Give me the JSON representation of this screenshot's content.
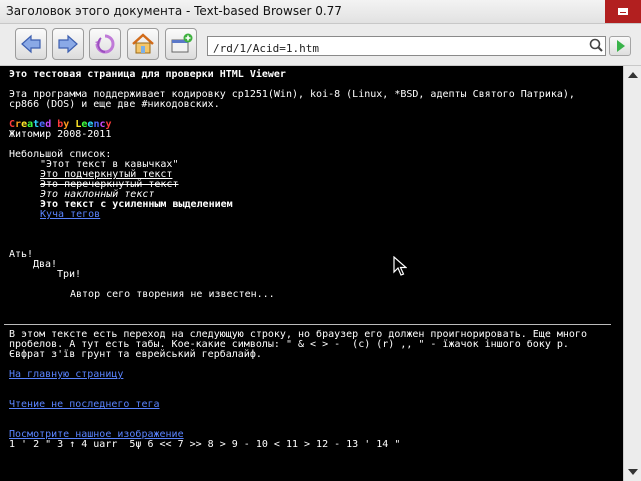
{
  "window": {
    "title": "Заголовок этого документа - Text-based Browser 0.77"
  },
  "toolbar": {
    "back_icon": "back-arrow-icon",
    "forward_icon": "forward-arrow-icon",
    "reload_icon": "reload-icon",
    "home_icon": "home-icon",
    "bookmark_icon": "add-bookmark-icon",
    "url": "/rd/1/Acid=1.htm"
  },
  "page": {
    "heading": "Это тестовая страница для проверки HTML Viewer",
    "intro_1": "Эта программа поддерживает кодировку cp1251(Win), koi-8 (Linux, *BSD, адепты Святого Патрика),",
    "intro_2": "cp866 (DOS) и еще две #никодовских.",
    "created_by": [
      "C",
      "r",
      "e",
      "a",
      "t",
      "e",
      "d",
      " ",
      "b",
      "y",
      " ",
      "L",
      "e",
      "e",
      "n",
      "c",
      "y"
    ],
    "created_colors": [
      "#ff3b3b",
      "#ff9d1f",
      "#ffe62a",
      "#40ff40",
      "#2fd7ff",
      "#4d6bff",
      "#c84dff",
      "#fff",
      "#ff3b3b",
      "#ff9d1f",
      "#fff",
      "#ffe62a",
      "#40ff40",
      "#2fd7ff",
      "#4d6bff",
      "#c84dff",
      "#ff3b3b"
    ],
    "city": "Житомир 2008-2011",
    "list_title": "Небольшой список:",
    "list": {
      "quoted": "\"Этот текст в кавычках\"",
      "underlined": "Это подчеркнутый текст",
      "strike": "Это перечеркнутый текст",
      "italic": "Это наклонный текст",
      "bold": "Это текст с усиленным выделением",
      "tags_link": "Куча тегов"
    },
    "stairs_1": "Ать!",
    "stairs_2": "Два!",
    "stairs_3": "Три!",
    "author": "Автор сего творения не известен...",
    "para_1": "В этом тексте есть переход на следующую строку, но браузер его должен проигнорировать. Еще много",
    "para_2": "пробелов. А тут есть табы. Кое-какие символы: \" & < > -  (c) (r) ,, \" - їжачок іншого боку р.",
    "para_3": "Євфрат з'їв грунт та еврейський гербалайф.",
    "link_home": "На главную страницу",
    "link_tag": "Чтение не последнего тега",
    "link_image": "Посмотрите нашное изображение",
    "entities": "1 ' 2 \" 3 ↑ 4 uarr  5ψ 6 << 7 >> 8 > 9 - 10 < 11 > 12 - 13 ' 14 \""
  },
  "colors": {
    "link": "#5a84ff",
    "close": "#b21f1f",
    "background": "#000000"
  }
}
